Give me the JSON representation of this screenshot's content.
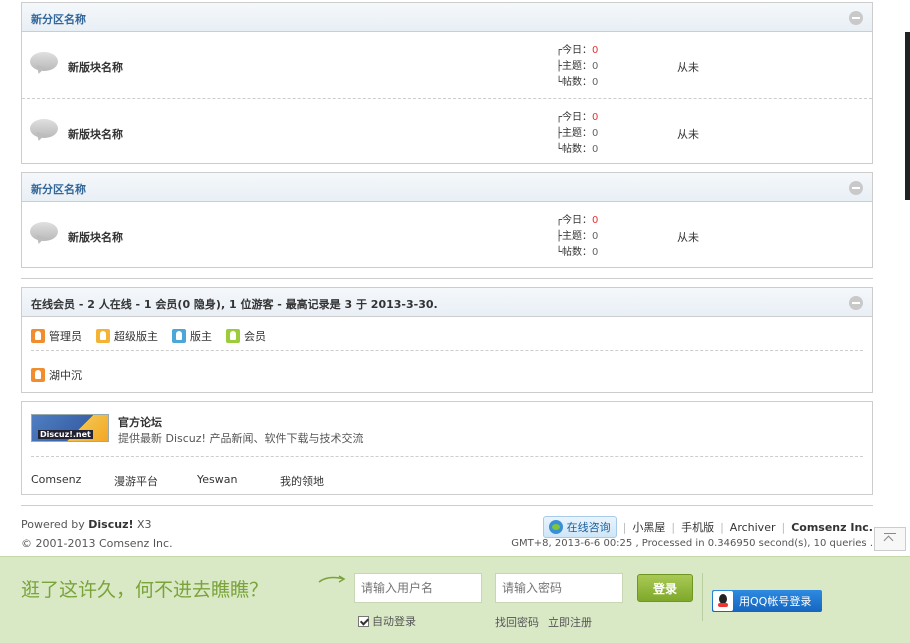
{
  "categories": [
    {
      "title": "新分区名称",
      "forums": [
        {
          "name": "新版块名称",
          "today_label": "┌今日：",
          "today": "0",
          "threads_label": "├主题：",
          "threads": "0",
          "posts_label": "└帖数：",
          "posts": "0",
          "lastpost": "从未"
        },
        {
          "name": "新版块名称",
          "today_label": "┌今日：",
          "today": "0",
          "threads_label": "├主题：",
          "threads": "0",
          "posts_label": "└帖数：",
          "posts": "0",
          "lastpost": "从未"
        }
      ]
    },
    {
      "title": "新分区名称",
      "forums": [
        {
          "name": "新版块名称",
          "today_label": "┌今日：",
          "today": "0",
          "threads_label": "├主题：",
          "threads": "0",
          "posts_label": "└帖数：",
          "posts": "0",
          "lastpost": "从未"
        }
      ]
    }
  ],
  "online": {
    "title": "在线会员 - 2 人在线 - 1 会员(0 隐身), 1 位游客 - 最高记录是 3 于 2013-3-30.",
    "legend": [
      "管理员",
      "超级版主",
      "版主",
      "会员"
    ],
    "user": "湖中沉"
  },
  "friendlink": {
    "logo_text": "Discuz!.net",
    "title": "官方论坛",
    "desc": "提供最新 Discuz! 产品新闻、软件下载与技术交流",
    "links": [
      "Comsenz",
      "漫游平台",
      "Yeswan",
      "我的领地"
    ]
  },
  "footer": {
    "powered_prefix": "Powered by ",
    "powered_brand": "Discuz!",
    "powered_version": " X3",
    "copyright": "© 2001-2013 Comsenz Inc.",
    "consult": "在线咨询",
    "links": [
      "小黑屋",
      "手机版",
      "Archiver"
    ],
    "company": "Comsenz Inc.",
    "debug": "GMT+8, 2013-6-6 00:25 , Processed in 0.346950 second(s), 10 queries ."
  },
  "loginbar": {
    "slogan": "逛了这许久，何不进去瞧瞧？",
    "username_placeholder": "请输入用户名",
    "password_placeholder": "请输入密码",
    "login": "登录",
    "auto_login": "自动登录",
    "forgot": "找回密码",
    "register": "立即注册",
    "qq_login": "用QQ帐号登录"
  },
  "colors": {
    "accent_blue": "#336699",
    "stat_red": "#e53333",
    "bar_green": "#d9e9c6",
    "slogan_green": "#7aa33a"
  }
}
